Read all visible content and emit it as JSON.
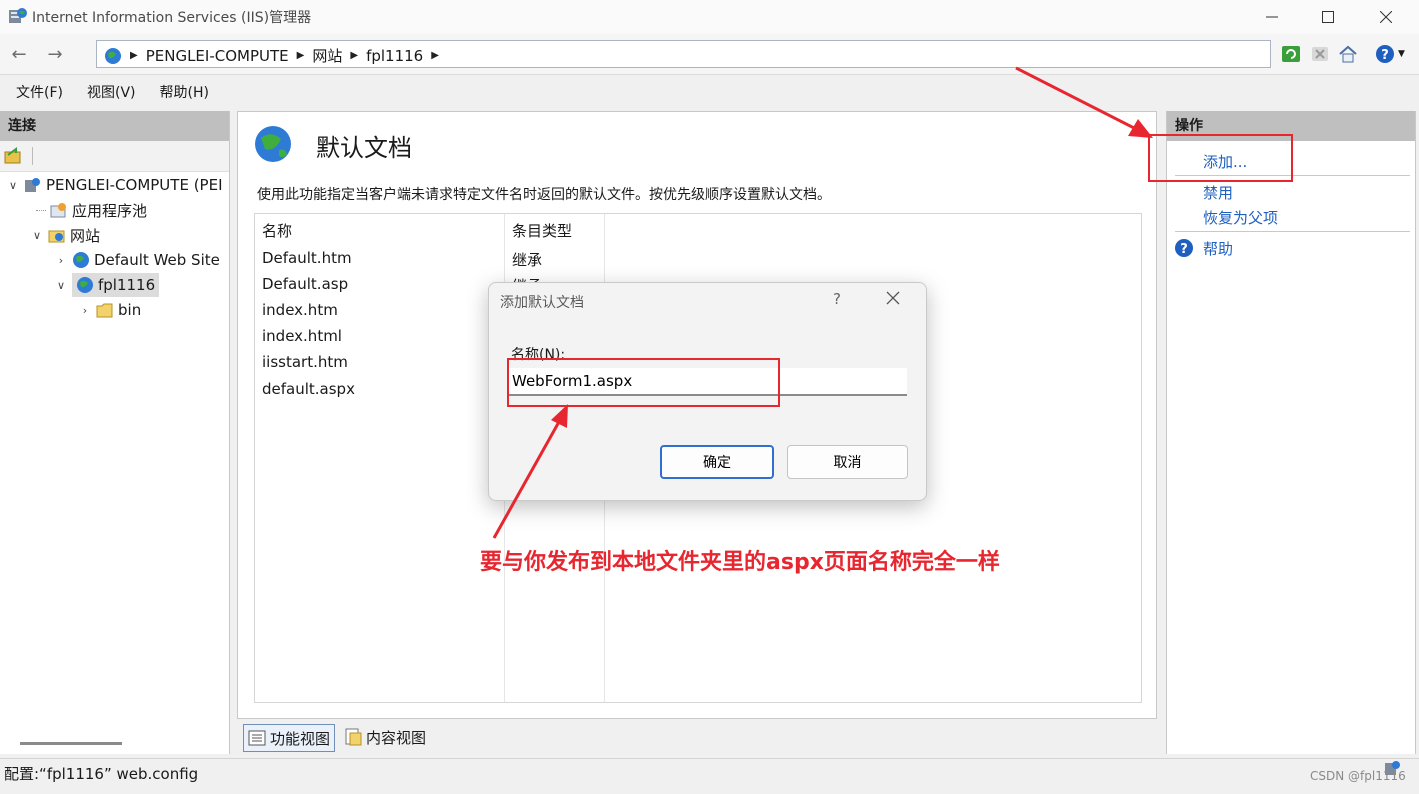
{
  "window": {
    "title": "Internet Information Services (IIS)管理器",
    "icons": {
      "app": "iis-manager-icon",
      "minimize": "minimize-icon",
      "maximize": "maximize-icon",
      "close": "close-icon"
    }
  },
  "address_bar": {
    "breadcrumbs": [
      "PENGLEI-COMPUTE",
      "网站",
      "fpl1116"
    ],
    "icons": [
      "back-icon",
      "forward-icon",
      "globe-icon",
      "refresh-icon",
      "stop-icon",
      "home-icon",
      "help-icon"
    ]
  },
  "menu": [
    "文件(F)",
    "视图(V)",
    "帮助(H)"
  ],
  "connections": {
    "header": "连接",
    "tree": [
      {
        "label": "PENGLEI-COMPUTE (PEI",
        "expanded": true,
        "icon": "server-icon"
      },
      {
        "label": "应用程序池",
        "icon": "app-pool-icon"
      },
      {
        "label": "网站",
        "expanded": true,
        "icon": "sites-folder-icon"
      },
      {
        "label": "Default Web Site",
        "expanded": false,
        "icon": "globe-icon"
      },
      {
        "label": "fpl1116",
        "expanded": true,
        "selected": true,
        "icon": "globe-icon"
      },
      {
        "label": "bin",
        "expanded": false,
        "icon": "folder-icon"
      }
    ]
  },
  "main": {
    "title": "默认文档",
    "description": "使用此功能指定当客户端未请求特定文件名时返回的默认文件。按优先级顺序设置默认文档。",
    "columns": [
      "名称",
      "条目类型"
    ],
    "rows": [
      {
        "name": "Default.htm",
        "type": "继承"
      },
      {
        "name": "Default.asp",
        "type": "继承"
      },
      {
        "name": "index.htm",
        "type": ""
      },
      {
        "name": "index.html",
        "type": ""
      },
      {
        "name": "iisstart.htm",
        "type": ""
      },
      {
        "name": "default.aspx",
        "type": ""
      }
    ],
    "view_tabs": [
      "功能视图",
      "内容视图"
    ]
  },
  "actions": {
    "header": "操作",
    "items": [
      "添加...",
      "禁用",
      "恢复为父项"
    ],
    "help": "帮助"
  },
  "dialog": {
    "title": "添加默认文档",
    "help_glyph": "?",
    "name_label": "名称(N):",
    "name_value": "WebForm1.aspx",
    "ok": "确定",
    "cancel": "取消"
  },
  "status": {
    "text": "配置:“fpl1116” web.config",
    "watermark": "CSDN @fpl1116"
  },
  "annotation": {
    "text": "要与你发布到本地文件夹里的aspx页面名称完全一样",
    "color": "#e8262f"
  }
}
